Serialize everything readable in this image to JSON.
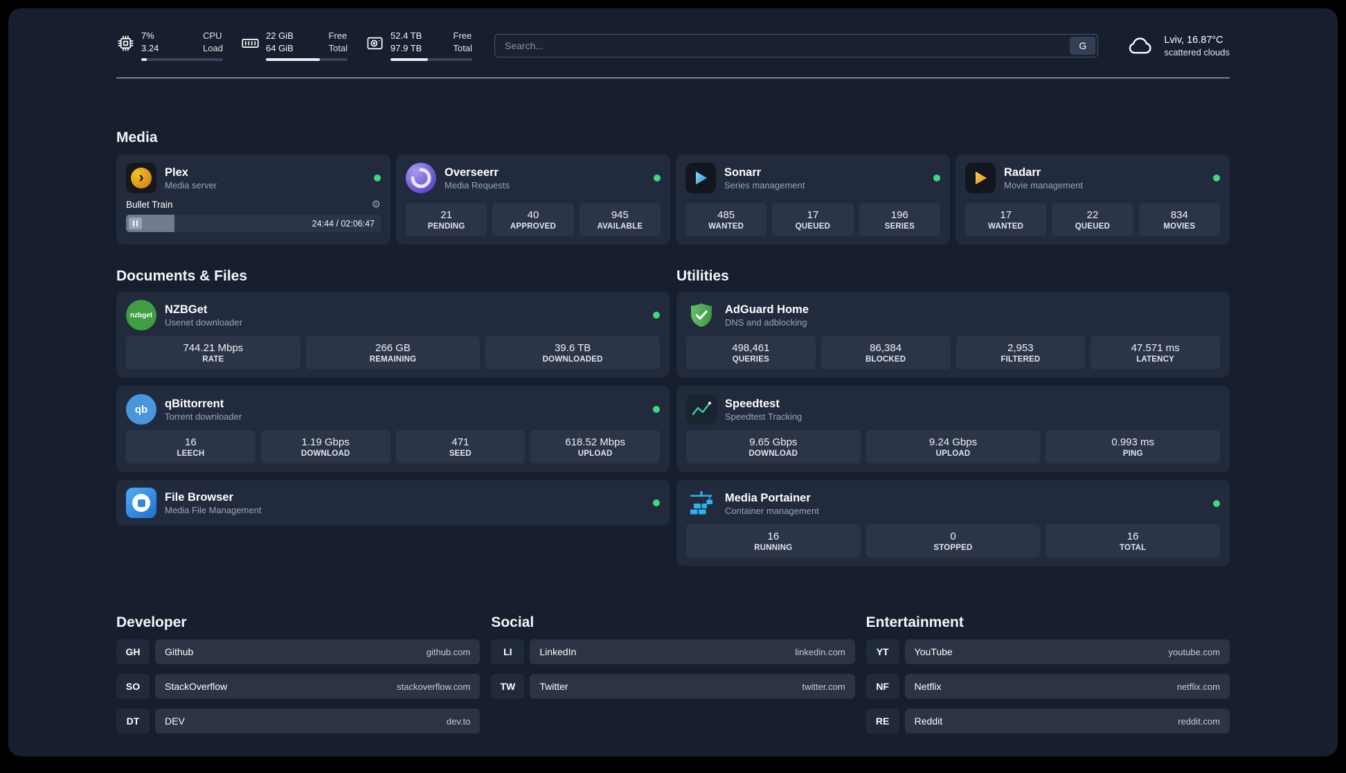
{
  "colors": {
    "status_online": "#40d977",
    "background": "#171f2e",
    "card": "#222b3d",
    "tile": "#2c3548",
    "accent_plex": "#e5a00d",
    "accent_overseerr": "#5948c8",
    "accent_sonarr": "#35c5f4",
    "accent_radarr": "#f7c30f",
    "accent_nzbget": "#3f9e43",
    "accent_qbittorrent": "#4b95dc",
    "accent_filebrowser": "#2f89d8",
    "accent_adguard": "#58b063",
    "accent_speedtest": "#34d399",
    "accent_portainer": "#2db3ec"
  },
  "header": {
    "cpu": {
      "icon": "cpu-chip-icon",
      "percent": "7%",
      "load": "3.24",
      "label_top": "CPU",
      "label_bottom": "Load",
      "bar_percent": 7
    },
    "ram": {
      "icon": "memory-icon",
      "free": "22 GiB",
      "total": "64 GiB",
      "label_top": "Free",
      "label_bottom": "Total",
      "bar_percent": 66
    },
    "disk": {
      "icon": "hard-disk-icon",
      "free": "52.4 TB",
      "total": "97.9 TB",
      "label_top": "Free",
      "label_bottom": "Total",
      "bar_percent": 46
    },
    "search": {
      "placeholder": "Search...",
      "engine_button": "G"
    },
    "weather": {
      "icon": "cloud-icon",
      "location": "Lviv, 16.87°C",
      "condition": "scattered clouds"
    }
  },
  "sections": {
    "media": "Media",
    "documents": "Documents & Files",
    "utilities": "Utilities",
    "developer": "Developer",
    "social": "Social",
    "entertainment": "Entertainment"
  },
  "media": {
    "plex": {
      "name": "Plex",
      "subtitle": "Media server",
      "glyph": "›",
      "gear": "⚙",
      "now_playing": "Bullet Train",
      "time": "24:44 / 02:06:47",
      "progress_percent": 19,
      "status": "online"
    },
    "overseerr": {
      "name": "Overseerr",
      "subtitle": "Media Requests",
      "status": "online",
      "stats": [
        {
          "value": "21",
          "label": "PENDING"
        },
        {
          "value": "40",
          "label": "APPROVED"
        },
        {
          "value": "945",
          "label": "AVAILABLE"
        }
      ]
    },
    "sonarr": {
      "name": "Sonarr",
      "subtitle": "Series management",
      "status": "online",
      "stats": [
        {
          "value": "485",
          "label": "WANTED"
        },
        {
          "value": "17",
          "label": "QUEUED"
        },
        {
          "value": "196",
          "label": "SERIES"
        }
      ]
    },
    "radarr": {
      "name": "Radarr",
      "subtitle": "Movie management",
      "status": "online",
      "stats": [
        {
          "value": "17",
          "label": "WANTED"
        },
        {
          "value": "22",
          "label": "QUEUED"
        },
        {
          "value": "834",
          "label": "MOVIES"
        }
      ]
    }
  },
  "documents": {
    "nzbget": {
      "name": "NZBGet",
      "subtitle": "Usenet downloader",
      "status": "online",
      "stats": [
        {
          "value": "744.21 Mbps",
          "label": "RATE"
        },
        {
          "value": "266 GB",
          "label": "REMAINING"
        },
        {
          "value": "39.6 TB",
          "label": "DOWNLOADED"
        }
      ]
    },
    "qbittorrent": {
      "name": "qBittorrent",
      "subtitle": "Torrent downloader",
      "status": "online",
      "stats": [
        {
          "value": "16",
          "label": "LEECH"
        },
        {
          "value": "1.19 Gbps",
          "label": "DOWNLOAD"
        },
        {
          "value": "471",
          "label": "SEED"
        },
        {
          "value": "618.52 Mbps",
          "label": "UPLOAD"
        }
      ]
    },
    "filebrowser": {
      "name": "File Browser",
      "subtitle": "Media File Management",
      "status": "online"
    }
  },
  "utilities": {
    "adguard": {
      "name": "AdGuard Home",
      "subtitle": "DNS and adblocking",
      "stats": [
        {
          "value": "498,461",
          "label": "QUERIES"
        },
        {
          "value": "86,384",
          "label": "BLOCKED"
        },
        {
          "value": "2,953",
          "label": "FILTERED"
        },
        {
          "value": "47.571 ms",
          "label": "LATENCY"
        }
      ]
    },
    "speedtest": {
      "name": "Speedtest",
      "subtitle": "Speedtest Tracking",
      "stats": [
        {
          "value": "9.65 Gbps",
          "label": "DOWNLOAD"
        },
        {
          "value": "9.24 Gbps",
          "label": "UPLOAD"
        },
        {
          "value": "0.993 ms",
          "label": "PING"
        }
      ]
    },
    "portainer": {
      "name": "Media Portainer",
      "subtitle": "Container management",
      "status": "online",
      "stats": [
        {
          "value": "16",
          "label": "RUNNING"
        },
        {
          "value": "0",
          "label": "STOPPED"
        },
        {
          "value": "16",
          "label": "TOTAL"
        }
      ]
    }
  },
  "links": {
    "developer": [
      {
        "abbr": "GH",
        "name": "Github",
        "url": "github.com"
      },
      {
        "abbr": "SO",
        "name": "StackOverflow",
        "url": "stackoverflow.com"
      },
      {
        "abbr": "DT",
        "name": "DEV",
        "url": "dev.to"
      }
    ],
    "social": [
      {
        "abbr": "LI",
        "name": "LinkedIn",
        "url": "linkedin.com"
      },
      {
        "abbr": "TW",
        "name": "Twitter",
        "url": "twitter.com"
      }
    ],
    "entertainment": [
      {
        "abbr": "YT",
        "name": "YouTube",
        "url": "youtube.com"
      },
      {
        "abbr": "NF",
        "name": "Netflix",
        "url": "netflix.com"
      },
      {
        "abbr": "RE",
        "name": "Reddit",
        "url": "reddit.com"
      }
    ]
  },
  "icons": {
    "cpu": "cpu-chip-icon",
    "ram": "memory-icon",
    "disk": "hard-disk-icon",
    "weather": "cloud-icon",
    "plex": "plex-chevron-icon",
    "overseerr": "overseerr-swirl-icon",
    "sonarr": "play-triangle-icon",
    "radarr": "play-triangle-icon",
    "nzbget_text": "nzbget",
    "qbittorrent_text": "qb",
    "filebrowser": "folder-circle-icon",
    "adguard": "shield-check-icon",
    "speedtest": "line-graph-icon",
    "portainer": "crane-containers-icon",
    "gear": "settings-gear-icon",
    "pause": "pause-icon"
  }
}
